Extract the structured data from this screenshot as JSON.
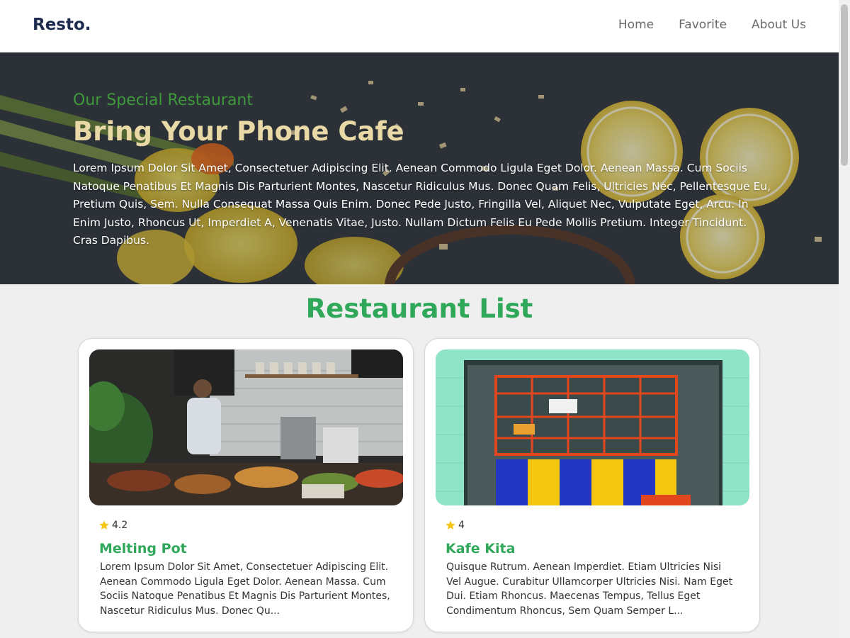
{
  "header": {
    "brand": "Resto.",
    "nav": [
      "Home",
      "Favorite",
      "About Us"
    ]
  },
  "hero": {
    "subtitle": "Our Special Restaurant",
    "title": "Bring Your Phone Cafe",
    "text": "Lorem Ipsum Dolor Sit Amet, Consectetuer Adipiscing Elit. Aenean Commodo Ligula Eget Dolor. Aenean Massa. Cum Sociis Natoque Penatibus Et Magnis Dis Parturient Montes, Nascetur Ridiculus Mus. Donec Quam Felis, Ultricies Nec, Pellentesque Eu, Pretium Quis, Sem. Nulla Consequat Massa Quis Enim. Donec Pede Justo, Fringilla Vel, Aliquet Nec, Vulputate Eget, Arcu. In Enim Justo, Rhoncus Ut, Imperdiet A, Venenatis Vitae, Justo. Nullam Dictum Felis Eu Pede Mollis Pretium. Integer Tincidunt. Cras Dapibus."
  },
  "section": {
    "title": "Restaurant List"
  },
  "restaurants": [
    {
      "rating": "4.2",
      "name": "Melting Pot",
      "description": "Lorem Ipsum Dolor Sit Amet, Consectetuer Adipiscing Elit. Aenean Commodo Ligula Eget Dolor. Aenean Massa. Cum Sociis Natoque Penatibus Et Magnis Dis Parturient Montes, Nascetur Ridiculus Mus. Donec Qu..."
    },
    {
      "rating": "4",
      "name": "Kafe Kita",
      "description": "Quisque Rutrum. Aenean Imperdiet. Etiam Ultricies Nisi Vel Augue. Curabitur Ullamcorper Ultricies Nisi. Nam Eget Dui. Etiam Rhoncus. Maecenas Tempus, Tellus Eget Condimentum Rhoncus, Sem Quam Semper L..."
    }
  ],
  "colors": {
    "accent": "#2fa85a",
    "brand": "#1d2b4f",
    "hero_subtitle": "#3e9a3a",
    "hero_title": "#e9d9a6",
    "star": "#f5c518"
  },
  "icons": {
    "rating": "star-icon"
  }
}
